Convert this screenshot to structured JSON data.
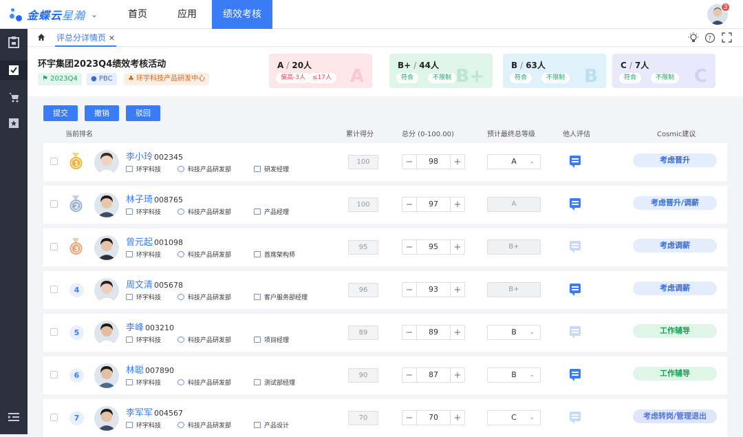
{
  "app": {
    "logo_text": "金蝶云",
    "logo_sub": "星瀚",
    "nav": [
      "首页",
      "应用",
      "绩效考核"
    ],
    "notif_count": "3"
  },
  "tabs": {
    "home_icon": "home-icon",
    "active": "评总分详情页",
    "close": "✕"
  },
  "activity": {
    "title": "环宇集团2023Q4绩效考核活动",
    "tags": [
      "2023Q4",
      "PBC",
      "环宇科技产品研发中心"
    ]
  },
  "grade_cards": [
    {
      "grade": "A",
      "count": "20人",
      "pills": [
        "偏高-3人",
        "≤17人"
      ],
      "color": "#fde6e8"
    },
    {
      "grade": "B+",
      "count": "44人",
      "pills": [
        "符合",
        "不限制"
      ],
      "color": "#dff5ea"
    },
    {
      "grade": "B",
      "count": "63人",
      "pills": [
        "符合",
        "不限制"
      ],
      "color": "#dff1fb"
    },
    {
      "grade": "C",
      "count": "7人",
      "pills": [
        "符合",
        "不限制"
      ],
      "color": "#e8eafc"
    }
  ],
  "actions": [
    "提交",
    "撤销",
    "驳回"
  ],
  "columns": {
    "rank": "当前排名",
    "cumulative": "累计得分",
    "total": "总分 (0-100.00)",
    "final": "预计最终总等级",
    "peer": "他人评估",
    "cosmic": "Cosmic建议"
  },
  "rows": [
    {
      "rank": "1",
      "name": "李小玲",
      "id": "002345",
      "company": "环宇科技",
      "dept": "科技产品研发部",
      "title": "研发经理",
      "cumulative": "100",
      "score": "98",
      "grade": "A",
      "grade_editable": true,
      "peer_active": true,
      "suggestion": "考虑晋升",
      "sug_type": "blue"
    },
    {
      "rank": "2",
      "name": "林子琦",
      "id": "008765",
      "company": "环宇科技",
      "dept": "科技产品研发部",
      "title": "产品经理",
      "cumulative": "100",
      "score": "97",
      "grade": "A",
      "grade_editable": false,
      "peer_active": true,
      "suggestion": "考虑晋升/调薪",
      "sug_type": "blue"
    },
    {
      "rank": "3",
      "name": "曾元起",
      "id": "001098",
      "company": "环宇科技",
      "dept": "科技产品研发部",
      "title": "首席架构师",
      "cumulative": "95",
      "score": "95",
      "grade": "B+",
      "grade_editable": false,
      "peer_active": false,
      "suggestion": "考虑调薪",
      "sug_type": "blue"
    },
    {
      "rank": "4",
      "name": "周文清",
      "id": "005678",
      "company": "环宇科技",
      "dept": "科技产品研发部",
      "title": "客户服务部经理",
      "cumulative": "96",
      "score": "93",
      "grade": "B+",
      "grade_editable": false,
      "peer_active": true,
      "suggestion": "考虑调薪",
      "sug_type": "blue"
    },
    {
      "rank": "5",
      "name": "李峰",
      "id": "003210",
      "company": "环宇科技",
      "dept": "科技产品研发部",
      "title": "项目经理",
      "cumulative": "89",
      "score": "89",
      "grade": "B",
      "grade_editable": true,
      "peer_active": false,
      "suggestion": "工作辅导",
      "sug_type": "green"
    },
    {
      "rank": "6",
      "name": "林聪",
      "id": "007890",
      "company": "环宇科技",
      "dept": "科技产品研发部",
      "title": "测试部经理",
      "cumulative": "90",
      "score": "87",
      "grade": "B",
      "grade_editable": true,
      "peer_active": true,
      "suggestion": "工作辅导",
      "sug_type": "green"
    },
    {
      "rank": "7",
      "name": "李军军",
      "id": "004567",
      "company": "环宇科技",
      "dept": "科技产品研发部",
      "title": "产品设计",
      "cumulative": "70",
      "score": "70",
      "grade": "C",
      "grade_editable": true,
      "peer_active": false,
      "suggestion": "考虑转岗/管理退出",
      "sug_type": "purple"
    }
  ]
}
